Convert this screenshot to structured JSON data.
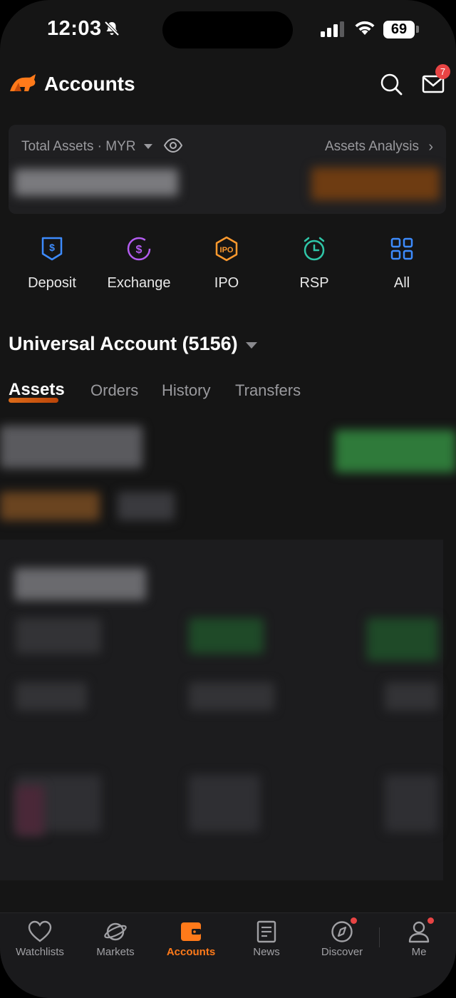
{
  "status_bar": {
    "time": "12:03",
    "battery": "69"
  },
  "header": {
    "title": "Accounts",
    "mail_badge": "7"
  },
  "assets_card": {
    "label": "Total Assets · MYR",
    "analysis_link": "Assets Analysis"
  },
  "quick_actions": [
    {
      "label": "Deposit",
      "icon": "deposit-icon",
      "color": "#3d8bfd"
    },
    {
      "label": "Exchange",
      "icon": "exchange-icon",
      "color": "#b35cf0"
    },
    {
      "label": "IPO",
      "icon": "ipo-icon",
      "color": "#ff9a2e"
    },
    {
      "label": "RSP",
      "icon": "rsp-clock-icon",
      "color": "#2fc6a8"
    },
    {
      "label": "All",
      "icon": "grid-icon",
      "color": "#3d8bfd"
    }
  ],
  "account": {
    "title": "Universal Account (5156)"
  },
  "tabs": [
    {
      "label": "Assets",
      "active": true
    },
    {
      "label": "Orders"
    },
    {
      "label": "History"
    },
    {
      "label": "Transfers"
    }
  ],
  "nav": [
    {
      "label": "Watchlists",
      "icon": "heart-icon"
    },
    {
      "label": "Markets",
      "icon": "planet-icon"
    },
    {
      "label": "Accounts",
      "icon": "wallet-icon",
      "active": true
    },
    {
      "label": "News",
      "icon": "news-icon"
    },
    {
      "label": "Discover",
      "icon": "compass-icon",
      "dot": true
    },
    {
      "label": "Me",
      "icon": "person-icon",
      "dot": true
    }
  ],
  "colors": {
    "accent": "#ff7a1a",
    "badge": "#e84444",
    "background": "#151515"
  }
}
